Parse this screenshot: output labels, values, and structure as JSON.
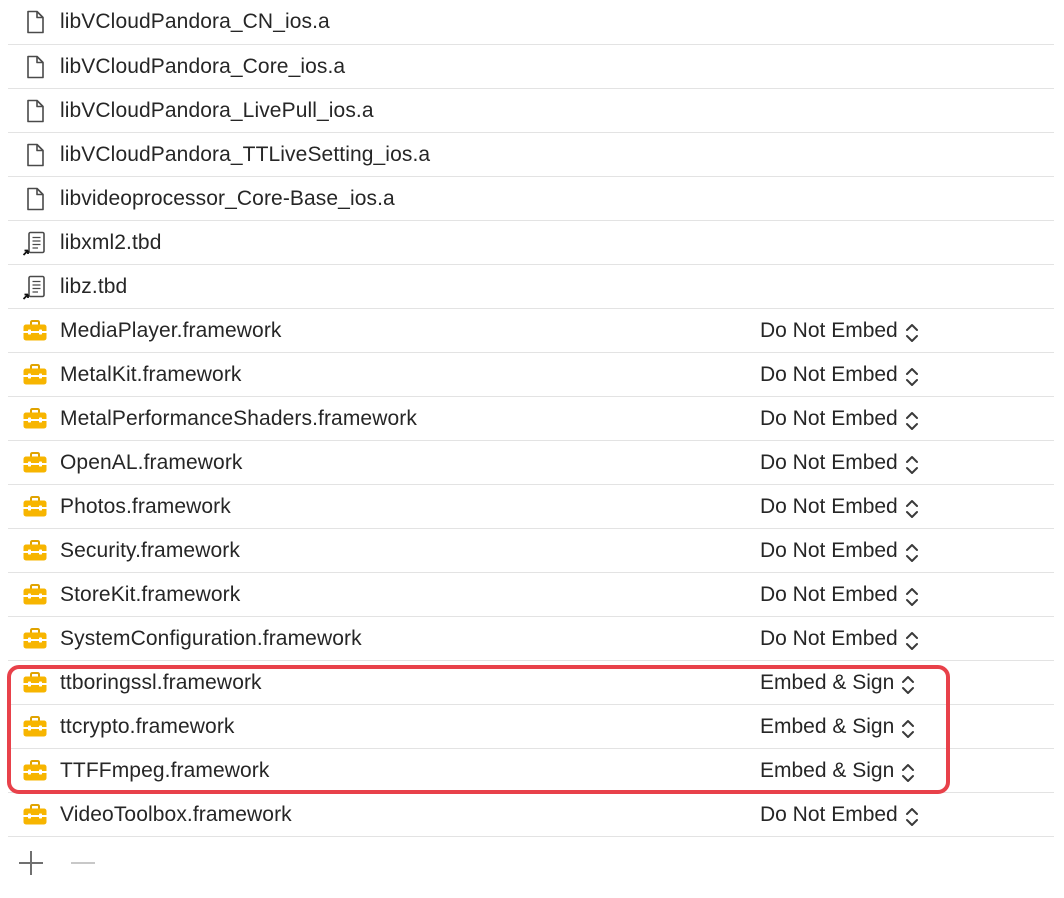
{
  "list": {
    "items": [
      {
        "name": "libVCloudPandora_CN_ios.a",
        "icon": "file-icon",
        "embed": null
      },
      {
        "name": "libVCloudPandora_Core_ios.a",
        "icon": "file-icon",
        "embed": null
      },
      {
        "name": "libVCloudPandora_LivePull_ios.a",
        "icon": "file-icon",
        "embed": null
      },
      {
        "name": "libVCloudPandora_TTLiveSetting_ios.a",
        "icon": "file-icon",
        "embed": null
      },
      {
        "name": "libvideoprocessor_Core-Base_ios.a",
        "icon": "file-icon",
        "embed": null
      },
      {
        "name": "libxml2.tbd",
        "icon": "tbd-alias-icon",
        "embed": null
      },
      {
        "name": "libz.tbd",
        "icon": "tbd-alias-icon",
        "embed": null
      },
      {
        "name": "MediaPlayer.framework",
        "icon": "framework-toolbox-icon",
        "embed": "Do Not Embed"
      },
      {
        "name": "MetalKit.framework",
        "icon": "framework-toolbox-icon",
        "embed": "Do Not Embed"
      },
      {
        "name": "MetalPerformanceShaders.framework",
        "icon": "framework-toolbox-icon",
        "embed": "Do Not Embed"
      },
      {
        "name": "OpenAL.framework",
        "icon": "framework-toolbox-icon",
        "embed": "Do Not Embed"
      },
      {
        "name": "Photos.framework",
        "icon": "framework-toolbox-icon",
        "embed": "Do Not Embed"
      },
      {
        "name": "Security.framework",
        "icon": "framework-toolbox-icon",
        "embed": "Do Not Embed"
      },
      {
        "name": "StoreKit.framework",
        "icon": "framework-toolbox-icon",
        "embed": "Do Not Embed"
      },
      {
        "name": "SystemConfiguration.framework",
        "icon": "framework-toolbox-icon",
        "embed": "Do Not Embed"
      },
      {
        "name": "ttboringssl.framework",
        "icon": "framework-toolbox-icon",
        "embed": "Embed & Sign"
      },
      {
        "name": "ttcrypto.framework",
        "icon": "framework-toolbox-icon",
        "embed": "Embed & Sign"
      },
      {
        "name": "TTFFmpeg.framework",
        "icon": "framework-toolbox-icon",
        "embed": "Embed & Sign"
      },
      {
        "name": "VideoToolbox.framework",
        "icon": "framework-toolbox-icon",
        "embed": "Do Not Embed"
      }
    ]
  },
  "toolbar": {
    "add_icon": "plus-icon",
    "remove_icon": "minus-icon"
  },
  "colors": {
    "highlight_border": "#e8414a",
    "toolbox_yellow": "#f7b500",
    "separator": "#e3e3e3",
    "text": "#262626"
  }
}
